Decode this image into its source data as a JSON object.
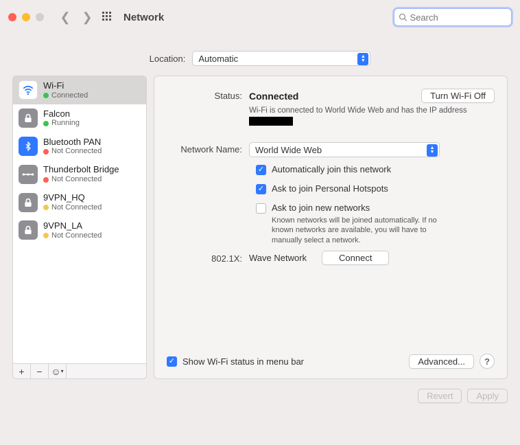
{
  "toolbar": {
    "title": "Network",
    "search_placeholder": "Search"
  },
  "location": {
    "label": "Location:",
    "value": "Automatic"
  },
  "services": [
    {
      "name": "Wi-Fi",
      "status": "Connected",
      "dot": "green",
      "iconCls": "wifi-bg",
      "icon": "wifi",
      "selected": true
    },
    {
      "name": "Falcon",
      "status": "Running",
      "dot": "green",
      "iconCls": "gray-bg",
      "icon": "lock"
    },
    {
      "name": "Bluetooth PAN",
      "status": "Not Connected",
      "dot": "reddot",
      "iconCls": "blue-bg",
      "icon": "bt"
    },
    {
      "name": "Thunderbolt Bridge",
      "status": "Not Connected",
      "dot": "reddot",
      "iconCls": "gray-bg",
      "icon": "tb"
    },
    {
      "name": "9VPN_HQ",
      "status": "Not Connected",
      "dot": "yellowdot",
      "iconCls": "gray-bg",
      "icon": "lock"
    },
    {
      "name": "9VPN_LA",
      "status": "Not Connected",
      "dot": "yellowdot",
      "iconCls": "gray-bg",
      "icon": "lock"
    }
  ],
  "details": {
    "status_label": "Status:",
    "status_value": "Connected",
    "toggle_button": "Turn Wi-Fi Off",
    "status_desc_1": "Wi-Fi is connected to World Wide Web and has the IP address ",
    "network_name_label": "Network Name:",
    "network_name_value": "World Wide Web",
    "cb_auto_join": "Automatically join this network",
    "cb_hotspot": "Ask to join Personal Hotspots",
    "cb_new": "Ask to join new networks",
    "cb_new_desc": "Known networks will be joined automatically. If no known networks are available, you will have to manually select a network.",
    "eight_label": "802.1X:",
    "eight_value": "Wave Network",
    "connect_btn": "Connect",
    "show_status": "Show Wi-Fi status in menu bar",
    "advanced_btn": "Advanced...",
    "help_btn": "?"
  },
  "footer": {
    "revert": "Revert",
    "apply": "Apply"
  }
}
